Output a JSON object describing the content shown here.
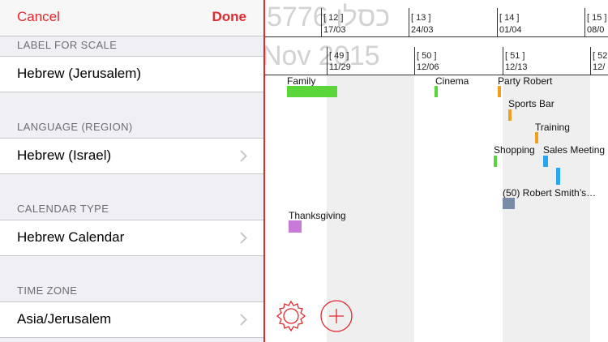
{
  "settings": {
    "cancel_label": "Cancel",
    "done_label": "Done",
    "sections": [
      {
        "header": "LABEL FOR SCALE",
        "value": "Hebrew (Jerusalem)"
      },
      {
        "header": "LANGUAGE (REGION)",
        "value": "Hebrew (Israel)"
      },
      {
        "header": "CALENDAR TYPE",
        "value": "Hebrew Calendar"
      },
      {
        "header": "TIME ZONE",
        "value": "Asia/Jerusalem"
      }
    ],
    "chevron_icon": "chevron-right-icon"
  },
  "timeline": {
    "watermark_top": "5776 כסלו",
    "watermark_bottom": "Nov 2015",
    "scale_top": [
      {
        "week": "[ 12 ]",
        "date": "17/03"
      },
      {
        "week": "[ 13 ]",
        "date": "24/03"
      },
      {
        "week": "[ 14 ]",
        "date": "01/04"
      },
      {
        "week": "[ 15 ]",
        "date": "08/0"
      }
    ],
    "scale_bottom": [
      {
        "week": "[ 49 ]",
        "date": "11/29"
      },
      {
        "week": "[ 50 ]",
        "date": "12/06"
      },
      {
        "week": "[ 51 ]",
        "date": "12/13"
      },
      {
        "week": "[ 52",
        "date": "12/"
      }
    ],
    "events": [
      {
        "label": "Family",
        "color": "#5bd63a"
      },
      {
        "label": "Cinema",
        "color": "#5bd63a"
      },
      {
        "label": "Party Robert",
        "color": "#f0a020"
      },
      {
        "label": "Sports Bar",
        "color": "#f0a020"
      },
      {
        "label": "Training",
        "color": "#f0a020"
      },
      {
        "label": "Shopping",
        "color": "#5bd63a"
      },
      {
        "label": "Sales Meeting",
        "color": "#2aa5f0"
      },
      {
        "label": "(50) Robert Smith’s…",
        "color": "#7a8ba8"
      },
      {
        "label": "Thanksgiving",
        "color": "#c878d8"
      }
    ],
    "toolbar": {
      "settings_icon": "gear-icon",
      "add_icon": "plus-circle-icon"
    },
    "accent_color": "#e2282d"
  }
}
